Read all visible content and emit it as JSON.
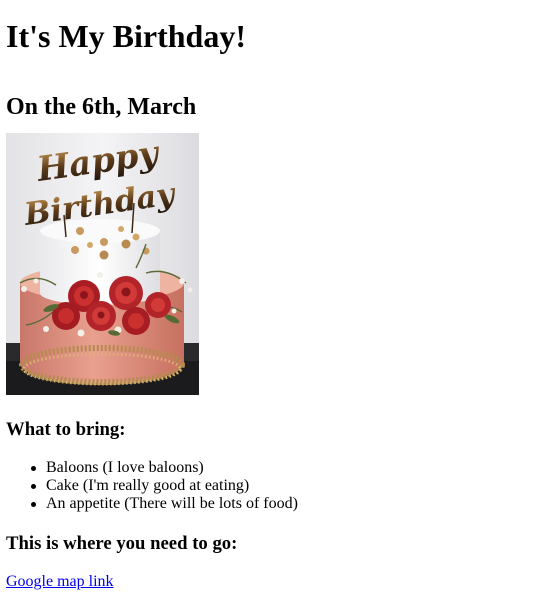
{
  "page": {
    "title": "It's My Birthday!",
    "date": "On the 6th, March",
    "image": {
      "icon": "birthday-cake-photo",
      "topper_text": [
        "Happy",
        "Birthday"
      ]
    },
    "bring": {
      "heading": "What to bring:",
      "items": [
        "Baloons (I love baloons)",
        "Cake (I'm really good at eating)",
        "An appetite (There will be lots of food)"
      ]
    },
    "location": {
      "heading": "This is where you need to go:",
      "link_text": "Google map link"
    }
  },
  "colors": {
    "link": "#0000ee",
    "text": "#000000",
    "background": "#ffffff"
  }
}
